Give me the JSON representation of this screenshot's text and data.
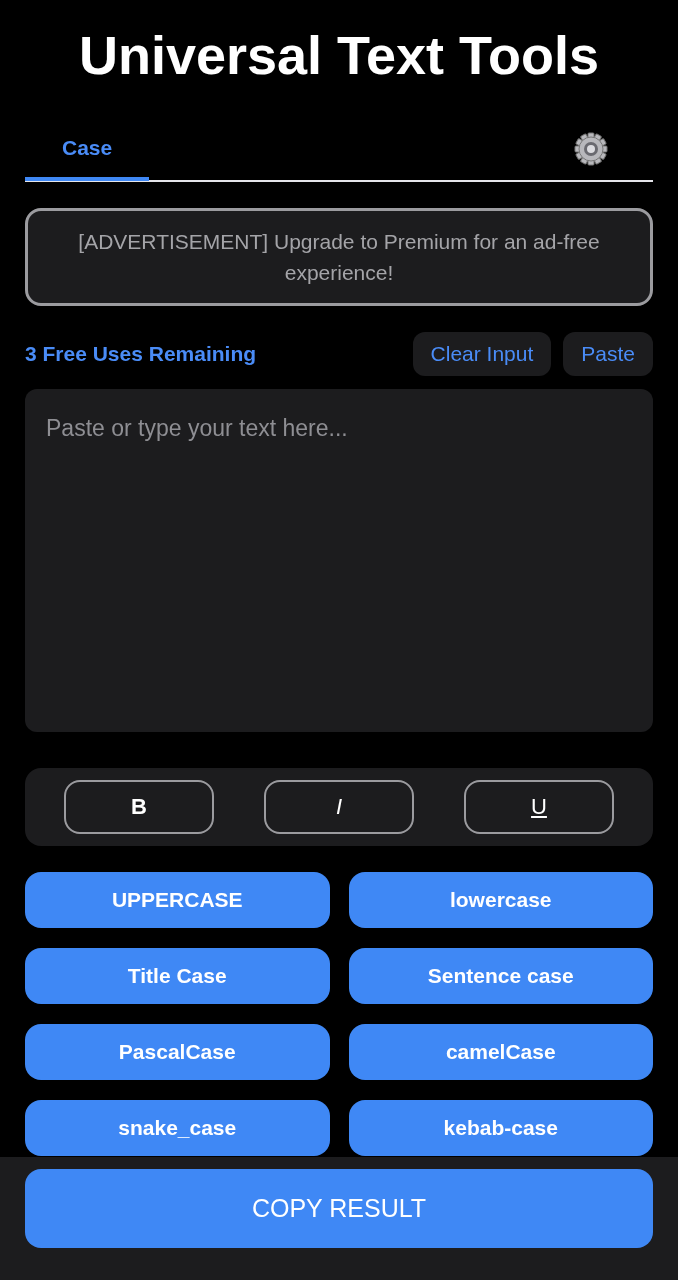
{
  "title": "Universal Text Tools",
  "tabs": [
    {
      "label": "Case",
      "selected": true
    }
  ],
  "ad": "[ADVERTISEMENT] Upgrade to Premium for an ad-free experience!",
  "uses_remaining": "3 Free Uses Remaining",
  "actions": [
    "Clear Input",
    "Paste"
  ],
  "input": {
    "placeholder": "Paste or type your text here..."
  },
  "format_buttons": [
    {
      "kind": "bold",
      "label": "B"
    },
    {
      "kind": "italic",
      "label": "I"
    },
    {
      "kind": "underline",
      "label": "U"
    }
  ],
  "case_buttons": [
    "UPPERCASE",
    "lowercase",
    "Title Case",
    "Sentence case",
    "PascalCase",
    "camelCase",
    "snake_case",
    "kebab-case"
  ],
  "copy_button": "COPY RESULT"
}
